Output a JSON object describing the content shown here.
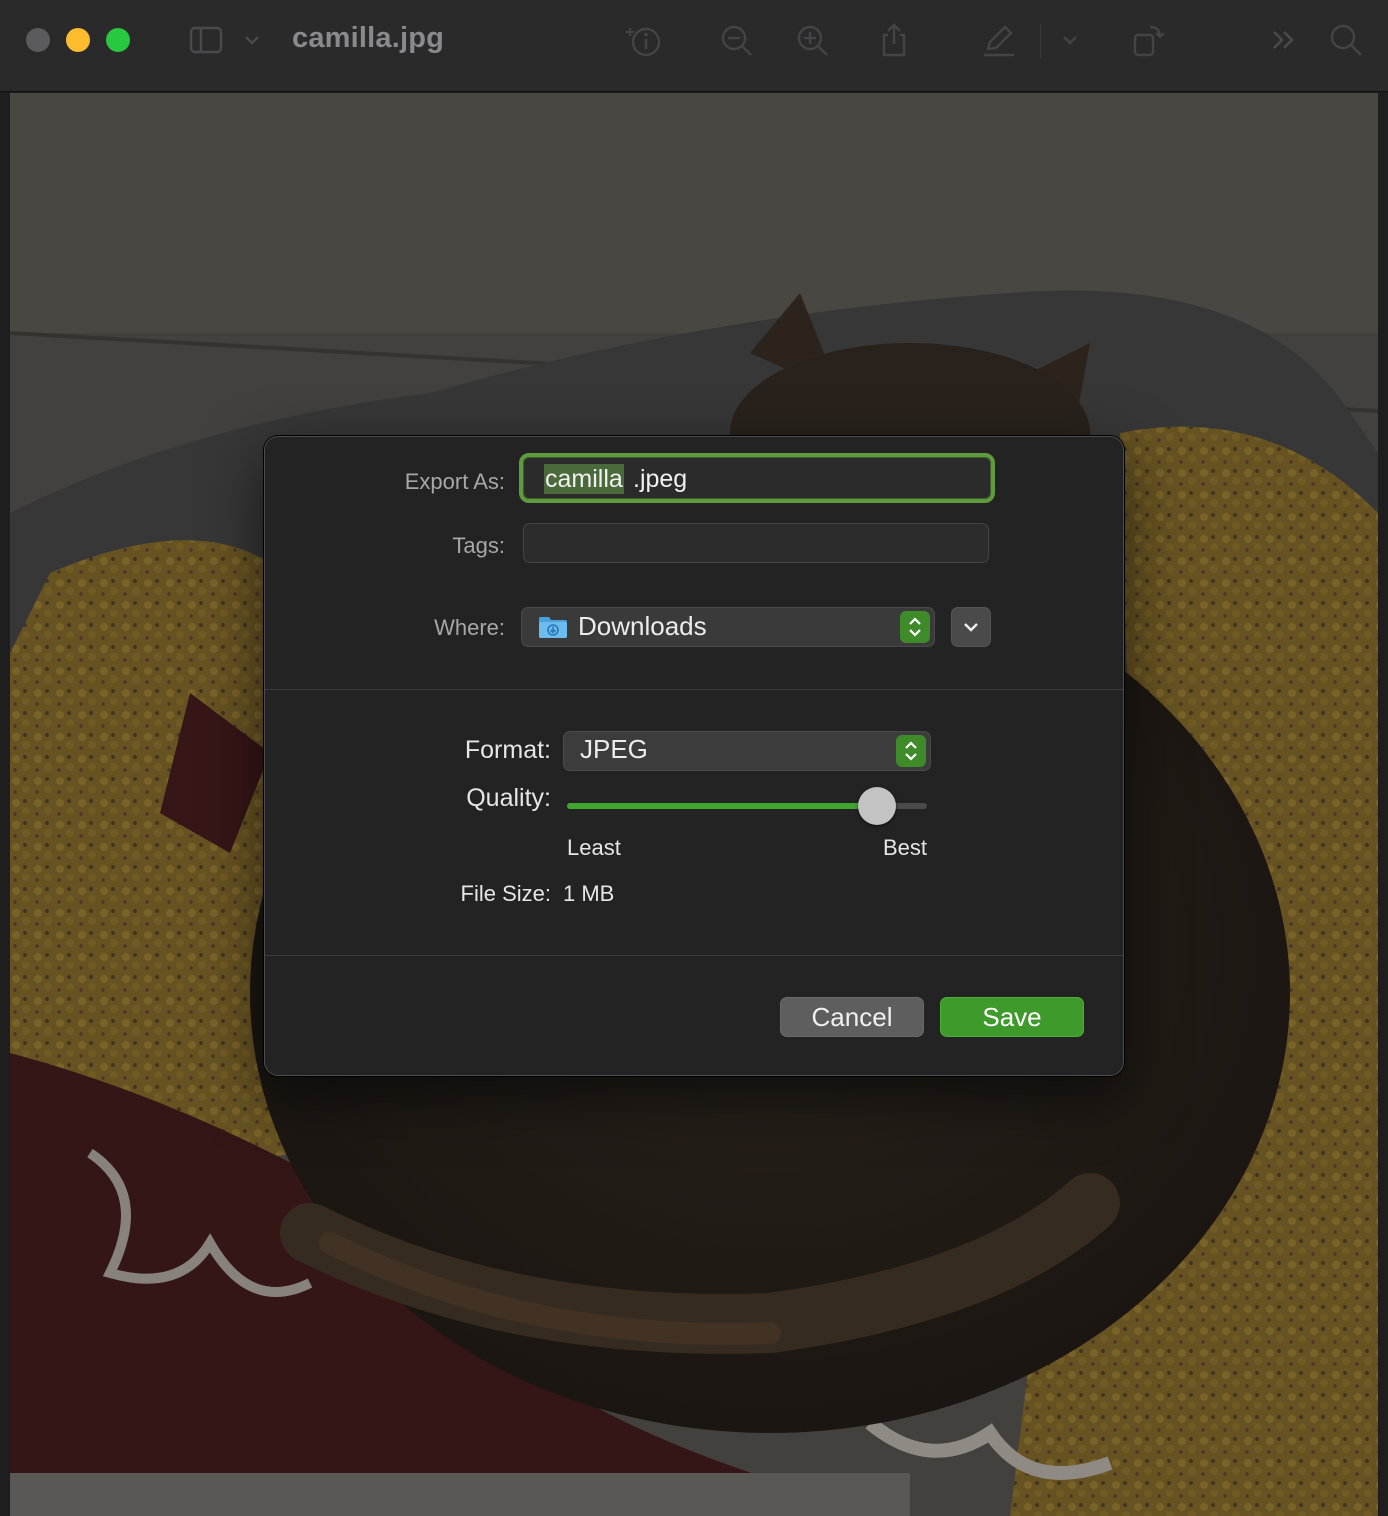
{
  "window": {
    "title": "camilla.jpg"
  },
  "toolbar": {
    "icons": [
      "sidebar-icon",
      "chevron-down-icon",
      "info-icon",
      "zoom-out-icon",
      "zoom-in-icon",
      "share-icon",
      "markup-icon",
      "chevron-down-icon",
      "rotate-icon",
      "more-icon",
      "search-icon"
    ]
  },
  "dialog": {
    "export_as_label": "Export As:",
    "filename_selected": "camilla",
    "filename_rest": ".jpeg",
    "tags_label": "Tags:",
    "tags_value": "",
    "where_label": "Where:",
    "where_value": "Downloads",
    "format_label": "Format:",
    "format_value": "JPEG",
    "quality_label": "Quality:",
    "quality_fraction": 0.86,
    "quality_min_label": "Least",
    "quality_max_label": "Best",
    "file_size_label": "File Size:",
    "file_size_value": "1 MB",
    "cancel_label": "Cancel",
    "save_label": "Save"
  },
  "colors": {
    "accent_green": "#3f9a2c",
    "focus_ring": "#5f9a3c",
    "slider_fill": "#41a62f"
  }
}
